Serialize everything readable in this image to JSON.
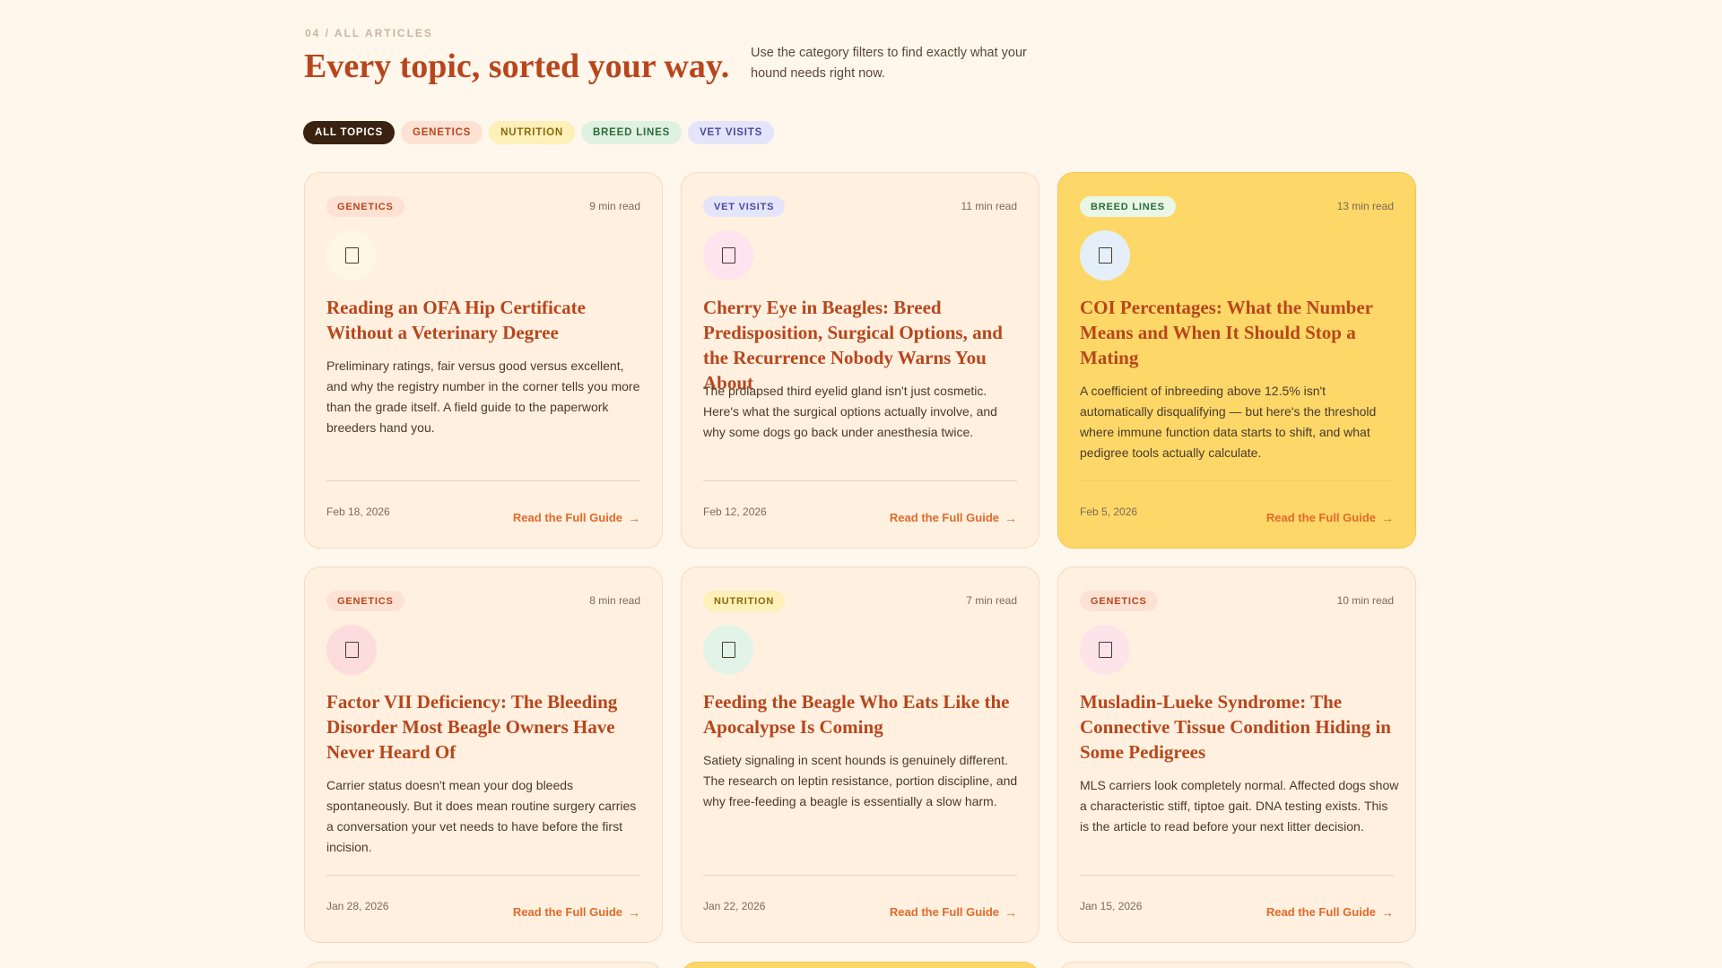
{
  "header": {
    "eyebrow": "04 / ALL ARTICLES",
    "title": "Every topic, sorted your way.",
    "intro": "Use the category filters to find exactly what your hound needs right now."
  },
  "filters": [
    {
      "label": "ALL TOPICS",
      "active": true
    },
    {
      "label": "GENETICS",
      "active": false
    },
    {
      "label": "NUTRITION",
      "active": false
    },
    {
      "label": "BREED LINES",
      "active": false
    },
    {
      "label": "VET VISITS",
      "active": false
    }
  ],
  "articles": [
    {
      "tag": "GENETICS",
      "read_time": "9 min read",
      "icon": "document-icon",
      "icon_bg": "#fff6e4",
      "title": "Reading an OFA Hip Certificate Without a Veterinary Degree",
      "excerpt": "Preliminary ratings, fair versus good versus excellent, and why the registry number in the corner tells you more than the grade itself. A field guide to the paperwork breeders hand you.",
      "date": "Feb 18, 2026",
      "cta": "Read the Full Guide"
    },
    {
      "tag": "VET VISITS",
      "read_time": "11 min read",
      "icon": "eye-icon",
      "icon_bg": "#fde4ee",
      "title": "Cherry Eye in Beagles: Breed Predisposition, Surgical Options, and the Recurrence Nobody Warns You About",
      "excerpt": "The prolapsed third eyelid gland isn't just cosmetic. Here's what the surgical options actually involve, and why some dogs go back under anesthesia twice.",
      "date": "Feb 12, 2026",
      "cta": "Read the Full Guide"
    },
    {
      "tag": "BREED LINES",
      "read_time": "13 min read",
      "icon": "pedigree-icon",
      "icon_bg": "#e4effa",
      "title": "COI Percentages: What the Number Means and When It Should Stop a Mating",
      "excerpt": "A coefficient of inbreeding above 12.5% isn't automatically disqualifying — but here's the threshold where immune function data starts to shift, and what pedigree tools actually calculate.",
      "date": "Feb 5, 2026",
      "cta": "Read the Full Guide"
    },
    {
      "tag": "GENETICS",
      "read_time": "8 min read",
      "icon": "blood-drop-icon",
      "icon_bg": "#fcdcdc",
      "title": "Factor VII Deficiency: The Bleeding Disorder Most Beagle Owners Have Never Heard Of",
      "excerpt": "Carrier status doesn't mean your dog bleeds spontaneously. But it does mean routine surgery carries a conversation your vet needs to have before the first incision.",
      "date": "Jan 28, 2026",
      "cta": "Read the Full Guide"
    },
    {
      "tag": "NUTRITION",
      "read_time": "7 min read",
      "icon": "food-bowl-icon",
      "icon_bg": "#e2f4e8",
      "title": "Feeding the Beagle Who Eats Like the Apocalypse Is Coming",
      "excerpt": "Satiety signaling in scent hounds is genuinely different. The research on leptin resistance, portion discipline, and why free-feeding a beagle is essentially a slow harm.",
      "date": "Jan 22, 2026",
      "cta": "Read the Full Guide"
    },
    {
      "tag": "GENETICS",
      "read_time": "10 min read",
      "icon": "dna-icon",
      "icon_bg": "#fce4ea",
      "title": "Musladin-Lueke Syndrome: The Connective Tissue Condition Hiding in Some Pedigrees",
      "excerpt": "MLS carriers look completely normal. Affected dogs show a characteristic stiff, tiptoe gait. DNA testing exists. This is the article to read before your next litter decision.",
      "date": "Jan 15, 2026",
      "cta": "Read the Full Guide"
    }
  ],
  "colors": {
    "background": "#fff6ec",
    "accent": "#b8461c",
    "cta": "#e06a2a",
    "featured": "#fdd868"
  }
}
